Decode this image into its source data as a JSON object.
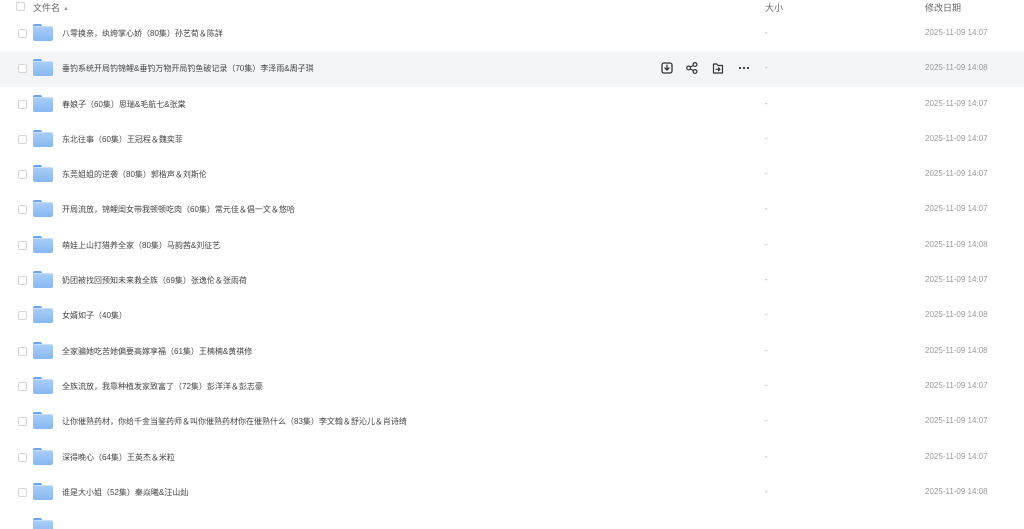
{
  "header": {
    "name_label": "文件名",
    "size_label": "大小",
    "date_label": "修改日期"
  },
  "hovered_row_index": 1,
  "icons": {
    "row_actions": [
      "download-icon",
      "share-icon",
      "move-icon",
      "more-icon"
    ],
    "folder": "folder-icon"
  },
  "colors": {
    "folder": "#8fbff4",
    "hover_row": "#f4f5f7"
  },
  "rows": [
    {
      "name": "八零换亲，纨绔掌心娇（80集）孙艺荀＆陈詳",
      "size": "-",
      "date": "2025-11-09 14:07"
    },
    {
      "name": "垂钓系统开局钓锦鲤&垂钓万物开局钓鱼破记录（70集）李泽雨&周子琪",
      "size": "-",
      "date": "2025-11-09 14:08"
    },
    {
      "name": "春娘子（60集）思瑞&毛航七&张棠",
      "size": "-",
      "date": "2025-11-09 14:07"
    },
    {
      "name": "东北往事（60集）王冠程＆魏奕菲",
      "size": "-",
      "date": "2025-11-09 14:07"
    },
    {
      "name": "东莞姐姐的逆袭（80集）郭楷声＆刘斯伦",
      "size": "-",
      "date": "2025-11-09 14:07"
    },
    {
      "name": "开局流放，锦鲤闺女带我顿顿吃肉（60集）常元佳＆倡一文＆悠哈",
      "size": "-",
      "date": "2025-11-09 14:07"
    },
    {
      "name": "萌娃上山打猎养全家（80集）马韵茜&刘征艺",
      "size": "-",
      "date": "2025-11-09 14:08"
    },
    {
      "name": "奶团被找回预知未来救全族（69集）张逸伦＆张雨荷",
      "size": "-",
      "date": "2025-11-09 14:07"
    },
    {
      "name": "女婿如子（40集）",
      "size": "-",
      "date": "2025-11-09 14:08"
    },
    {
      "name": "全家骗她吃苦她偏要高嫁享福（61集）王楠楠&黄祺修",
      "size": "-",
      "date": "2025-11-09 14:08"
    },
    {
      "name": "全族流放，我靠种植发家致富了（72集）彭洋洋＆彭志豪",
      "size": "-",
      "date": "2025-11-09 14:07"
    },
    {
      "name": "让你催熟药材，你给千金当鉴药师＆叫你催熟药材你在催熟什么（83集）李文翰＆舒沁儿＆肖诗绮",
      "size": "-",
      "date": "2025-11-09 14:07"
    },
    {
      "name": "深得晚心（64集）王英杰＆米粒",
      "size": "-",
      "date": "2025-11-09 14:07"
    },
    {
      "name": "谁是大小姐（52集）秦焱曦&汪山灿",
      "size": "-",
      "date": "2025-11-09 14:08"
    }
  ]
}
